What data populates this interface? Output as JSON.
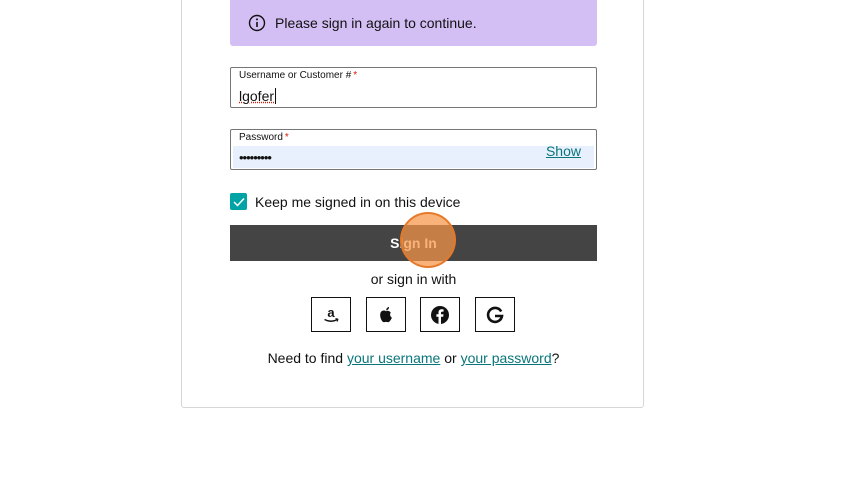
{
  "alert": {
    "message": "Please sign in again to continue.",
    "icon": "info-icon",
    "color": "#d4bff5"
  },
  "username": {
    "label": "Username or Customer #",
    "required": "*",
    "value": "lgofer"
  },
  "password": {
    "label": "Password",
    "required": "*",
    "value": "•••••••••",
    "show_label": "Show"
  },
  "remember": {
    "label": "Keep me signed in on this device",
    "checked": true
  },
  "signin": {
    "label": "Sign In"
  },
  "social": {
    "prompt": "or sign in with",
    "providers": [
      "amazon-icon",
      "apple-icon",
      "facebook-icon",
      "google-icon"
    ]
  },
  "help": {
    "prefix": "Need to find ",
    "username_link": "your username",
    "middle": " or ",
    "password_link": "your password",
    "suffix": "?"
  },
  "colors": {
    "accent": "#09757a",
    "checkbox": "#00a4a6",
    "button": "#444444"
  }
}
